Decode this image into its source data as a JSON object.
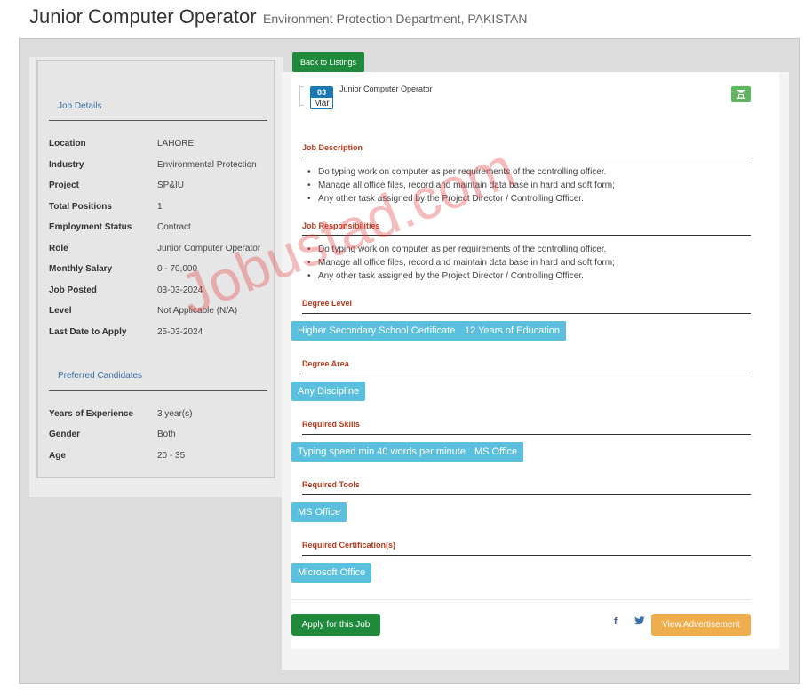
{
  "header": {
    "title": "Junior Computer Operator",
    "subtitle": "Environment Protection Department, PAKISTAN"
  },
  "left": {
    "job_details_title": "Job Details",
    "details": [
      {
        "label": "Location",
        "value": "LAHORE"
      },
      {
        "label": "Industry",
        "value": "Environmental Protection"
      },
      {
        "label": "Project",
        "value": "SP&IU"
      },
      {
        "label": "Total Positions",
        "value": "1"
      },
      {
        "label": "Employment Status",
        "value": "Contract"
      },
      {
        "label": "Role",
        "value": "Junior Computer Operator"
      },
      {
        "label": "Monthly Salary",
        "value": "0 - 70,000"
      },
      {
        "label": "Job Posted",
        "value": "03-03-2024"
      },
      {
        "label": "Level",
        "value": "Not Applicable (N/A)"
      },
      {
        "label": "Last Date to Apply",
        "value": "25-03-2024"
      }
    ],
    "preferred_title": "Preferred Candidates",
    "preferred": [
      {
        "label": "Years of Experience",
        "value": "3 year(s)"
      },
      {
        "label": "Gender",
        "value": "Both"
      },
      {
        "label": "Age",
        "value": "20 - 35"
      }
    ]
  },
  "back_label": "Back to Listings",
  "post": {
    "day": "03",
    "month": "Mar",
    "job_name": "Junior Computer Operator"
  },
  "sections": {
    "description_heading": "Job Description",
    "description": [
      "Do typing work on computer as per requirements of the controlling officer.",
      "Manage all office  files, record and maintain data base in hard and soft form;",
      "Any other task assigned by the Project Director / Controlling Officer."
    ],
    "responsibilities_heading": "Job Responsibilities",
    "responsibilities": [
      "Do typing work on computer as per requirements of the controlling officer.",
      "Manage all office  files, record and maintain data base in hard and soft form;",
      "Any other task assigned by the Project Director / Controlling Officer."
    ],
    "degree_level_heading": "Degree Level",
    "degree_level": [
      "Higher Secondary School Certificate",
      "12 Years of Education"
    ],
    "degree_area_heading": "Degree Area",
    "degree_area": [
      "Any Discipline"
    ],
    "skills_heading": "Required Skills",
    "skills": [
      "Typing speed min 40 words per minute",
      "MS Office"
    ],
    "tools_heading": "Required Tools",
    "tools": [
      "MS Office"
    ],
    "certs_heading": "Required Certification(s)",
    "certs": [
      "Microsoft Office"
    ]
  },
  "actions": {
    "apply_label": "Apply for this Job",
    "facebook_icon": "facebook-icon",
    "twitter_icon": "twitter-icon",
    "view_label": "View Advertisement"
  },
  "watermark": "Jobustad.com",
  "colors": {
    "green": "#1f8a3b",
    "tag": "#5bc0de",
    "orange": "#f0ad4e",
    "heading_red": "#b83a1e",
    "link_blue": "#3a6ea5"
  }
}
